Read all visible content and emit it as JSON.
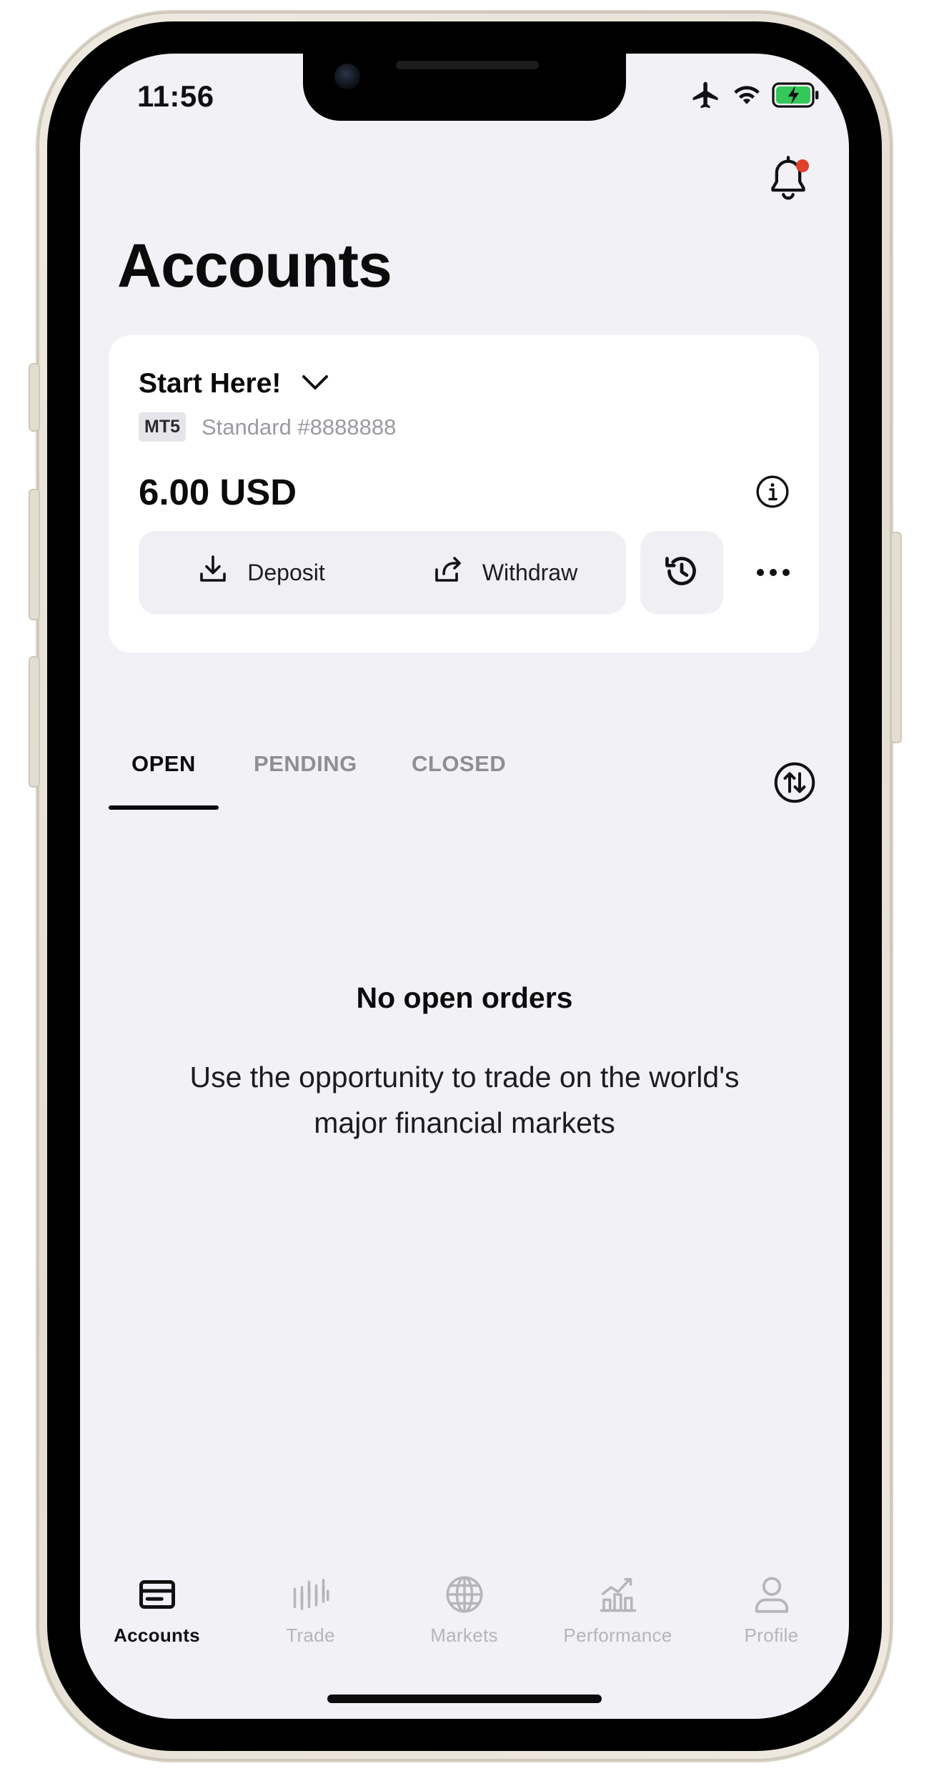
{
  "status_bar": {
    "time": "11:56"
  },
  "header": {
    "title": "Accounts",
    "notification_badge": true
  },
  "account_card": {
    "name": "Start Here!",
    "platform": "MT5",
    "account_type": "Standard #8888888",
    "balance": "6.00 USD",
    "deposit_label": "Deposit",
    "withdraw_label": "Withdraw"
  },
  "tabs": [
    {
      "label": "OPEN",
      "active": true
    },
    {
      "label": "PENDING",
      "active": false
    },
    {
      "label": "CLOSED",
      "active": false
    }
  ],
  "empty_state": {
    "title": "No open orders",
    "body": "Use the opportunity to trade on the world's major financial markets"
  },
  "bottom_nav": [
    {
      "label": "Accounts",
      "icon": "card-icon",
      "active": true
    },
    {
      "label": "Trade",
      "icon": "candles-icon",
      "active": false
    },
    {
      "label": "Markets",
      "icon": "globe-icon",
      "active": false
    },
    {
      "label": "Performance",
      "icon": "chart-icon",
      "active": false
    },
    {
      "label": "Profile",
      "icon": "user-icon",
      "active": false
    }
  ],
  "colors": {
    "screen_bg": "#f1f1f6",
    "card_bg": "#ffffff",
    "accent_dot": "#e0402c",
    "battery_fill": "#34c759",
    "inactive_nav": "#b5b5ba"
  }
}
